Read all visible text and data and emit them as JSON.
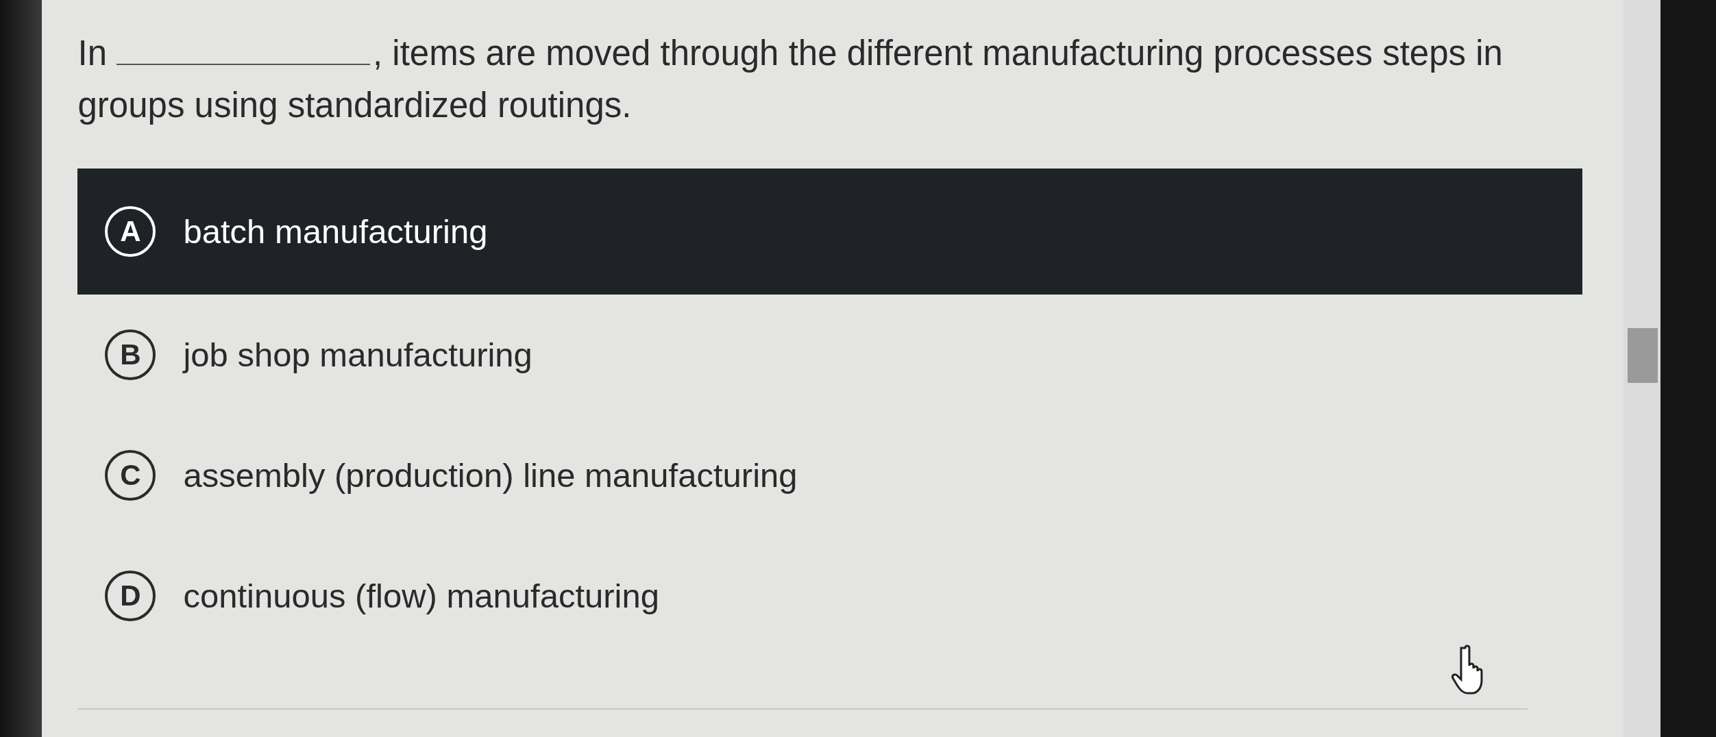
{
  "question": {
    "before": "In",
    "after": ", items are moved through the different manufacturing processes steps in groups using standardized routings."
  },
  "options": [
    {
      "letter": "A",
      "text": "batch manufacturing",
      "selected": true
    },
    {
      "letter": "B",
      "text": "job shop manufacturing",
      "selected": false
    },
    {
      "letter": "C",
      "text": "assembly (production) line manufacturing",
      "selected": false
    },
    {
      "letter": "D",
      "text": "continuous (flow) manufacturing",
      "selected": false
    }
  ]
}
